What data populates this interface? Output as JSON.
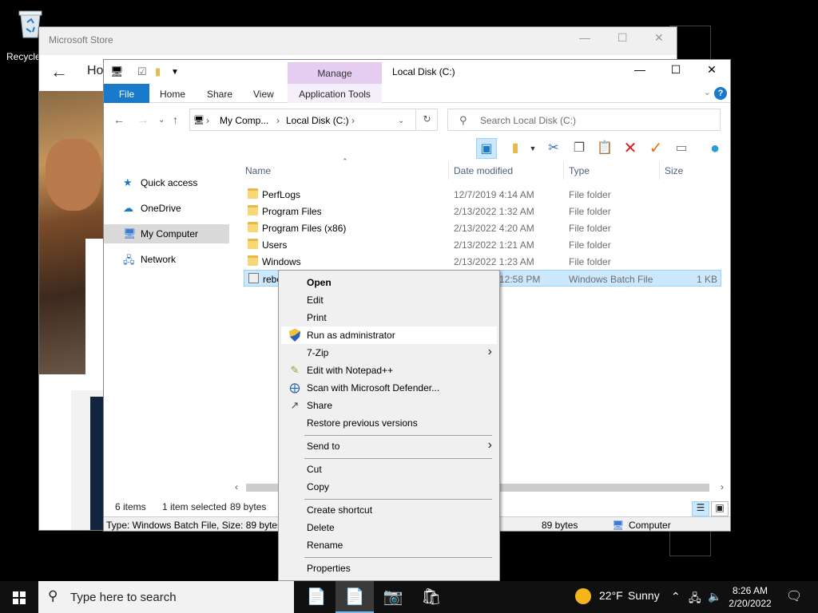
{
  "desktop": {
    "recycle_label": "Recycle"
  },
  "store_window": {
    "title": "Microsoft Store",
    "nav_label": "Ho"
  },
  "explorer": {
    "title": "Local Disk (C:)",
    "ribbon": {
      "manage": "Manage",
      "tabs": [
        "File",
        "Home",
        "Share",
        "View",
        "Application Tools"
      ]
    },
    "address": {
      "segments": [
        "My Comp...",
        "Local Disk (C:)"
      ]
    },
    "search_placeholder": "Search Local Disk (C:)",
    "nav": [
      "Quick access",
      "OneDrive",
      "My Computer",
      "Network"
    ],
    "columns": [
      "Name",
      "Date modified",
      "Type",
      "Size"
    ],
    "files": [
      {
        "name": "PerfLogs",
        "date": "12/7/2019 4:14 AM",
        "type": "File folder",
        "size": ""
      },
      {
        "name": "Program Files",
        "date": "2/13/2022 1:32 AM",
        "type": "File folder",
        "size": ""
      },
      {
        "name": "Program Files (x86)",
        "date": "2/13/2022 4:20 AM",
        "type": "File folder",
        "size": ""
      },
      {
        "name": "Users",
        "date": "2/13/2022 1:21 AM",
        "type": "File folder",
        "size": ""
      },
      {
        "name": "Windows",
        "date": "2/13/2022 1:23 AM",
        "type": "File folder",
        "size": ""
      },
      {
        "name": "rebo",
        "date": "12:58 PM",
        "type": "Windows Batch File",
        "size": "1 KB"
      }
    ],
    "status": {
      "items": "6 items",
      "selected": "1 item selected",
      "size": "89 bytes"
    },
    "details": {
      "left": "Type: Windows Batch File, Size: 89 bytes, I",
      "size": "89 bytes",
      "location": "Computer"
    }
  },
  "context_menu": {
    "items": [
      "Open",
      "Edit",
      "Print",
      "Run as administrator",
      "7-Zip",
      "Edit with Notepad++",
      "Scan with Microsoft Defender...",
      "Share",
      "Restore previous versions",
      "Send to",
      "Cut",
      "Copy",
      "Create shortcut",
      "Delete",
      "Rename",
      "Properties"
    ]
  },
  "taskbar": {
    "search_placeholder": "Type here to search",
    "weather_temp": "22°F",
    "weather_cond": "Sunny",
    "time": "8:26 AM",
    "date": "2/20/2022"
  },
  "colors": {
    "accent": "#1979ca",
    "manage_tab": "#e5cdf2",
    "selection": "#cce8ff",
    "taskbar": "#101010"
  }
}
